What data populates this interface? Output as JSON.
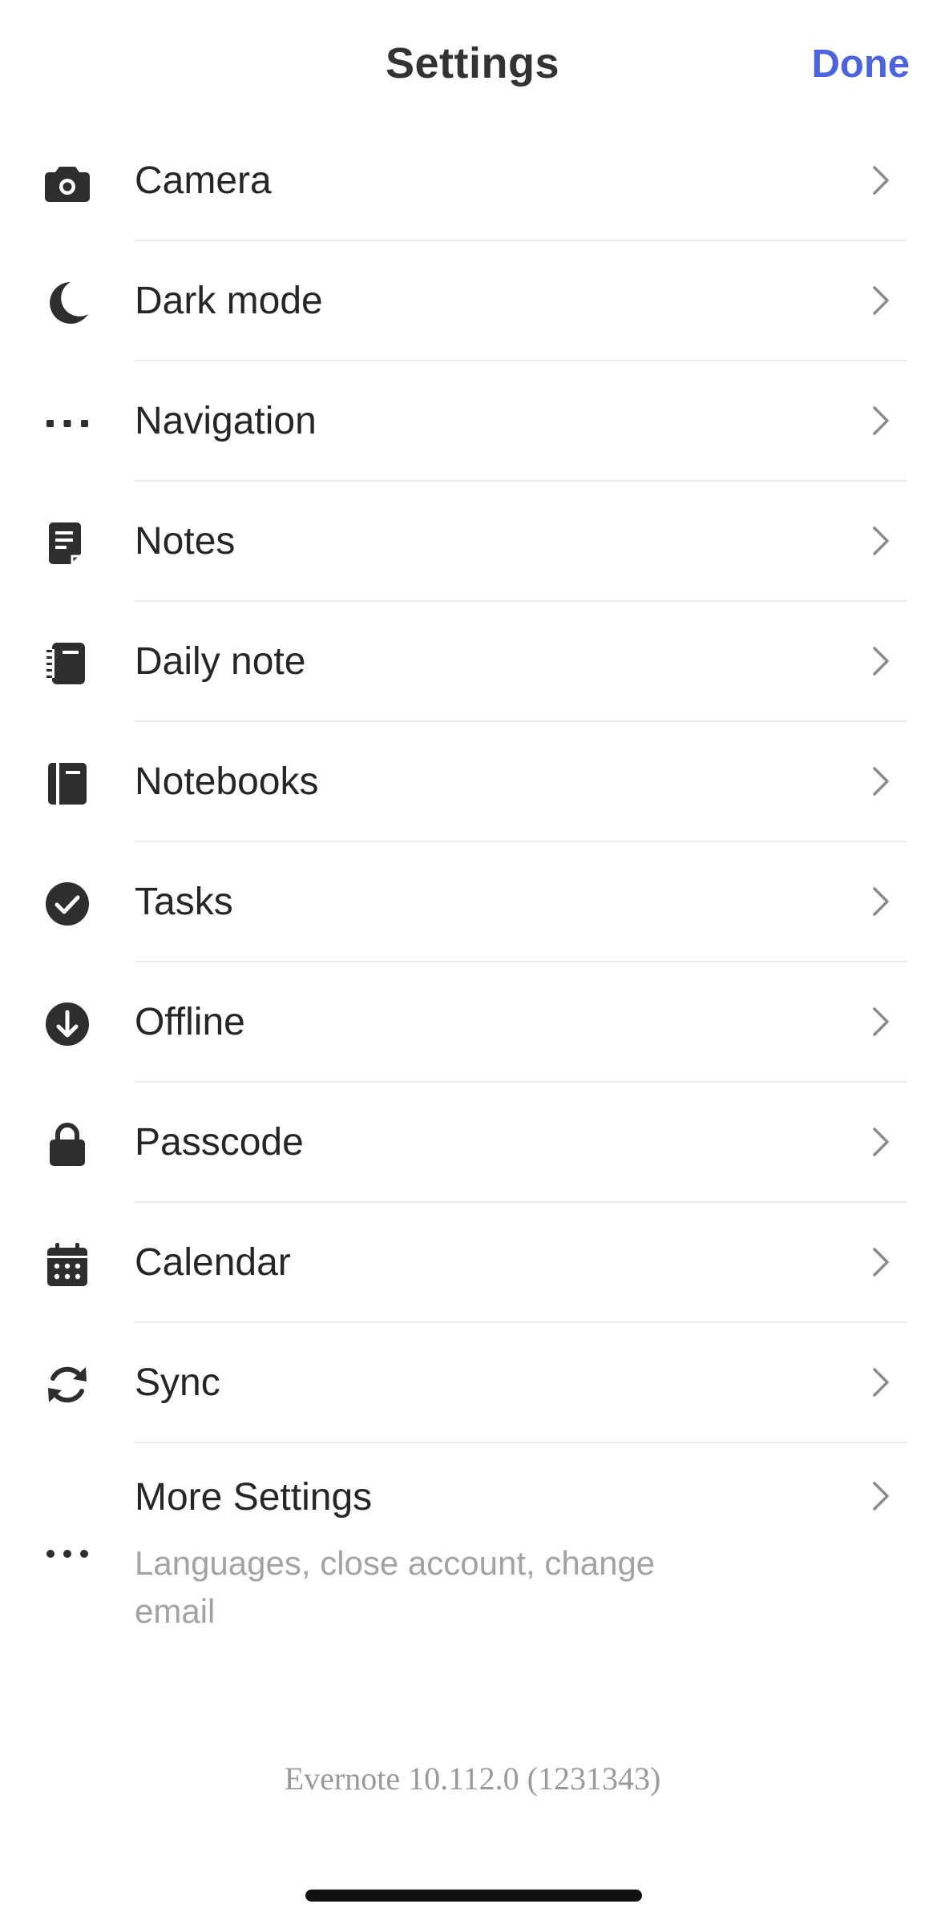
{
  "header": {
    "title": "Settings",
    "done_label": "Done"
  },
  "colors": {
    "accent": "#4b63e0",
    "text": "#262626",
    "secondary_text": "#a3a3a3",
    "divider": "#ebebeb",
    "icon": "#2e2e2e"
  },
  "settings": {
    "items": [
      {
        "label": "Camera",
        "icon": "camera-icon"
      },
      {
        "label": "Dark mode",
        "icon": "moon-icon"
      },
      {
        "label": "Navigation",
        "icon": "dots-icon"
      },
      {
        "label": "Notes",
        "icon": "note-icon"
      },
      {
        "label": "Daily note",
        "icon": "daily-note-icon"
      },
      {
        "label": "Notebooks",
        "icon": "notebook-icon"
      },
      {
        "label": "Tasks",
        "icon": "check-circle-icon"
      },
      {
        "label": "Offline",
        "icon": "download-circle-icon"
      },
      {
        "label": "Passcode",
        "icon": "lock-icon"
      },
      {
        "label": "Calendar",
        "icon": "calendar-icon"
      },
      {
        "label": "Sync",
        "icon": "sync-icon"
      }
    ],
    "more": {
      "label": "More Settings",
      "sublabel": "Languages, close account, change email",
      "icon": "more-icon"
    }
  },
  "footer": {
    "version": "Evernote 10.112.0 (1231343)"
  }
}
